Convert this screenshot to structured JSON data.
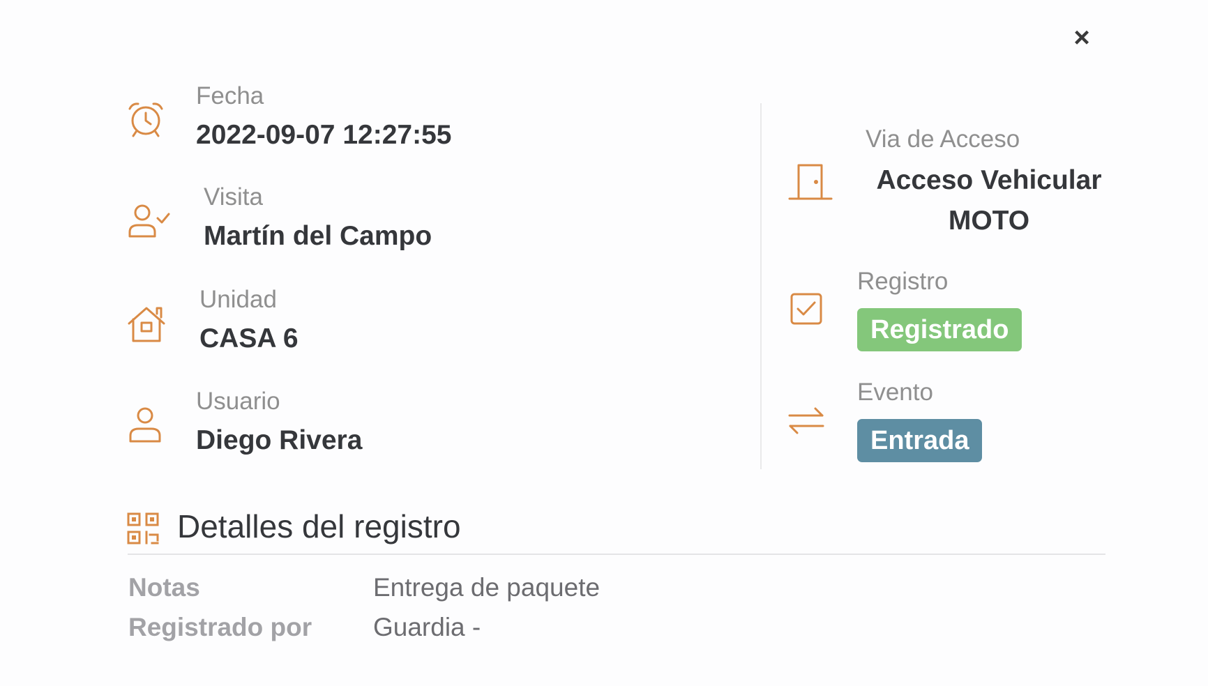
{
  "modal": {
    "close_label": "×"
  },
  "fecha": {
    "label": "Fecha",
    "value": "2022-09-07 12:27:55",
    "icon": "alarm-clock-icon"
  },
  "visita": {
    "label": "Visita",
    "value": "Martín del Campo",
    "icon": "user-check-icon"
  },
  "unidad": {
    "label": "Unidad",
    "value": "CASA 6",
    "icon": "house-icon"
  },
  "usuario": {
    "label": "Usuario",
    "value": "Diego Rivera",
    "icon": "user-icon"
  },
  "via_acceso": {
    "label": "Via de Acceso",
    "value_line1": "Acceso Vehicular",
    "value_line2": "MOTO",
    "icon": "door-icon"
  },
  "registro": {
    "label": "Registro",
    "badge": "Registrado",
    "badge_color": "#84c77b",
    "icon": "checkbox-icon"
  },
  "evento": {
    "label": "Evento",
    "badge": "Entrada",
    "badge_color": "#5e8ea3",
    "icon": "arrows-exchange-icon"
  },
  "details": {
    "title": "Detalles del registro",
    "icon": "qr-code-icon",
    "rows": [
      {
        "key": "Notas",
        "value": "Entrega de paquete"
      },
      {
        "key": "Registrado por",
        "value": "Guardia -"
      }
    ]
  },
  "colors": {
    "icon_accent": "#d98a45",
    "text_dark": "#35373b",
    "text_label": "#8f8f8f"
  }
}
